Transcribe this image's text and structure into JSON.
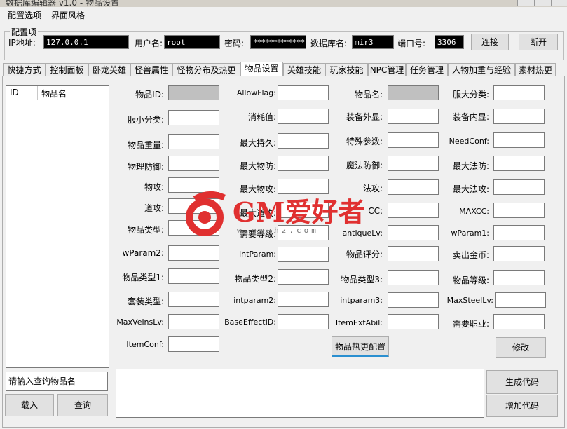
{
  "window": {
    "title": "数据库编辑器 v1.0 - 物品设置"
  },
  "menu": [
    "配置选项",
    "界面风格"
  ],
  "config": {
    "legend": "配置项",
    "ip_label": "IP地址:",
    "ip_value": "127.0.0.1",
    "user_label": "用户名:",
    "user_value": "root",
    "pwd_label": "密码:",
    "pwd_value": "*************",
    "db_label": "数据库名:",
    "db_value": "mir3",
    "port_label": "端口号:",
    "port_value": "3306",
    "connect_label": "连接",
    "disconnect_label": "断开"
  },
  "tabs": [
    "快捷方式",
    "控制面板",
    "卧龙英雄",
    "怪兽属性",
    "怪物分布及热更",
    "物品设置",
    "英雄技能",
    "玩家技能",
    "NPC管理",
    "任务管理",
    "人物加重与经验",
    "素材热更"
  ],
  "list": {
    "col_id": "ID",
    "col_name": "物品名"
  },
  "search": {
    "placeholder": "请输入查询物品名"
  },
  "buttons": {
    "load": "载入",
    "query": "查询",
    "hot_config": "物品热更配置",
    "modify": "修改",
    "generate": "生成代码",
    "add_code": "增加代码"
  },
  "fields": {
    "c1": [
      "物品ID:",
      "服小分类:",
      "物品重量:",
      "物理防御:",
      "物攻:",
      "道攻:",
      "物品类型:",
      "wParam2:",
      "物品类型1:",
      "套装类型:",
      "MaxVeinsLv:",
      "ItemConf:"
    ],
    "c2": [
      "AllowFlag:",
      "消耗值:",
      "最大持久:",
      "最大物防:",
      "最大物攻:",
      "最大道攻:",
      "需要等级:",
      "intParam:",
      "物品类型2:",
      "intparam2:",
      "BaseEffectID:"
    ],
    "c3": [
      "物品名:",
      "装备外显:",
      "特殊参数:",
      "魔法防御:",
      "法攻:",
      "CC:",
      "antiqueLv:",
      "物品评分:",
      "物品类型3:",
      "intparam3:",
      "ItemExtAbil:"
    ],
    "c4": [
      "服大分类:",
      "装备内显:",
      "NeedConf:",
      "最大法防:",
      "最大法攻:",
      "MAXCC:",
      "wParam1:",
      "卖出金币:",
      "物品等级:",
      "MaxSteelLv:",
      "需要职业:"
    ]
  },
  "watermark": {
    "text": "GM爱好者",
    "url": "w.gmahz.com"
  },
  "icons": {
    "logo": "gm-logo-icon"
  },
  "colors": {
    "watermark": "#e03030",
    "hot_button_accent": "#2a8fd0"
  }
}
